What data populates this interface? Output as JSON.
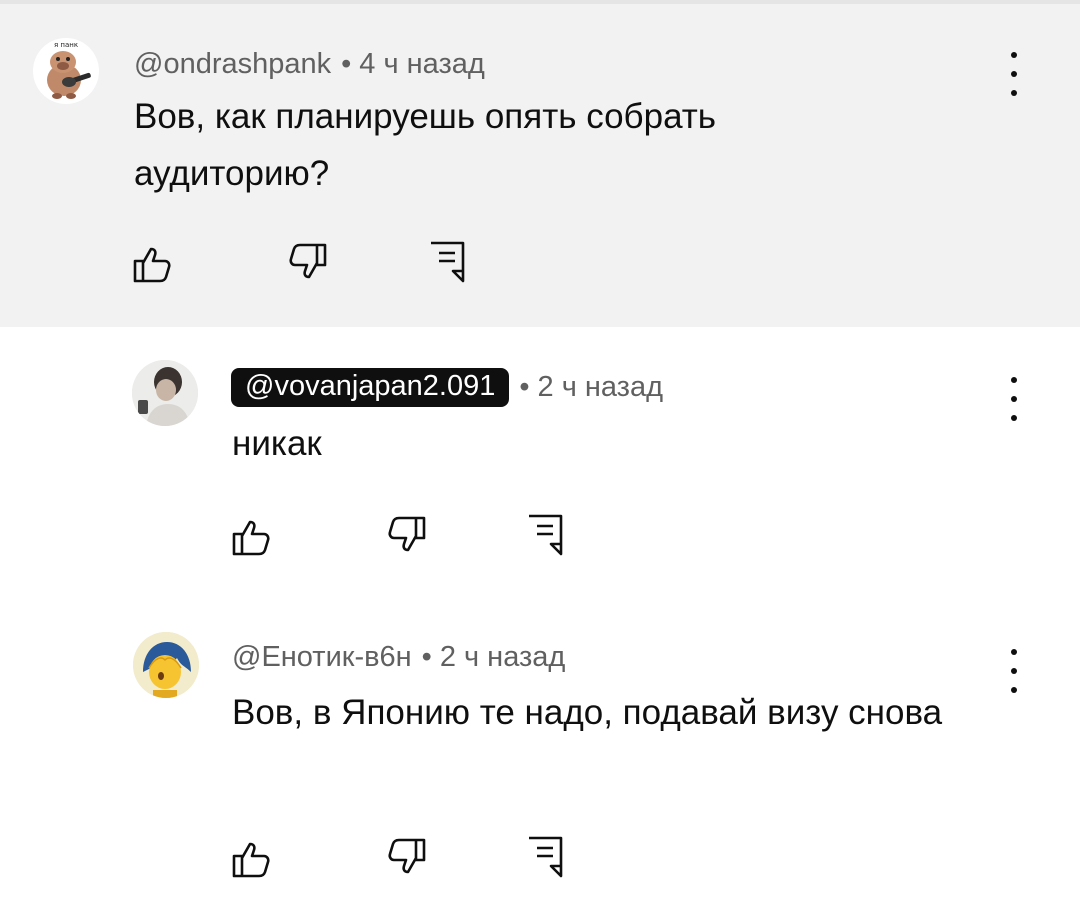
{
  "comments": [
    {
      "handle": "@ondrashpank",
      "separator": "•",
      "time": "4 ч назад",
      "text": "Вов, как планируешь опять собрать аудиторию?",
      "avatar_caption": "я панк",
      "avatar_icon": "cartoon-pig-guitar-avatar",
      "highlighted": true,
      "handle_highlighted": false
    },
    {
      "handle": "@vovanjapan2.091",
      "separator": "•",
      "time": "2 ч назад",
      "text": "никак",
      "avatar_icon": "person-photo-avatar",
      "highlighted": false,
      "handle_highlighted": true
    },
    {
      "handle": "@Енотик-в6н",
      "separator": "•",
      "time": "2 ч назад",
      "text": "Вов, в Японию те надо, подавай визу снова",
      "avatar_icon": "anime-character-avatar",
      "highlighted": false,
      "handle_highlighted": false
    }
  ],
  "icons": {
    "like": "thumbs-up-icon",
    "dislike": "thumbs-down-icon",
    "reply": "reply-comment-icon",
    "menu": "more-vert-icon"
  },
  "colors": {
    "highlight_bg": "#f2f2f2",
    "text": "#0f0f0f",
    "meta": "#606060",
    "pill_bg": "#0f0f0f"
  }
}
